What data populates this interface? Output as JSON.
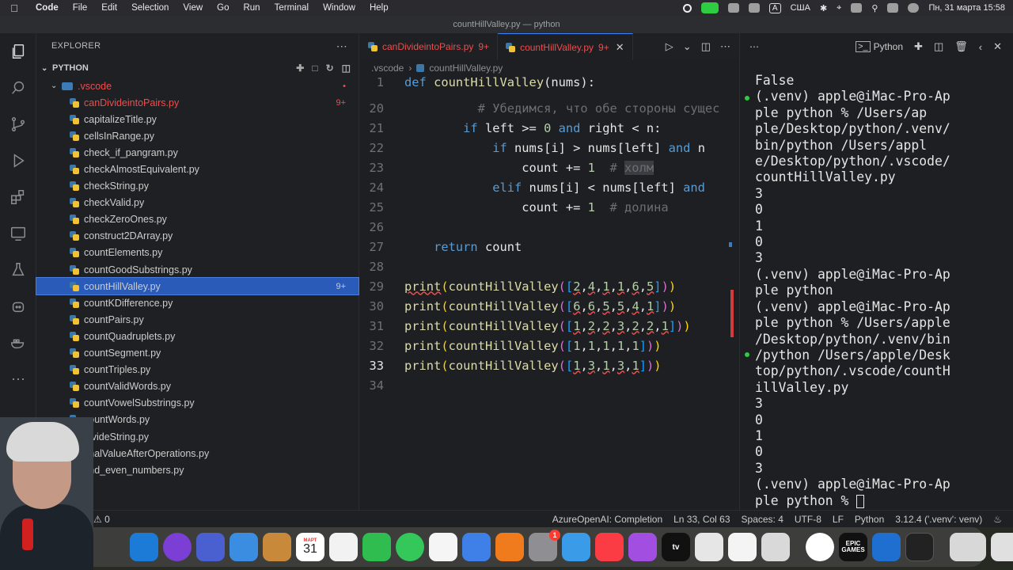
{
  "menubar": {
    "app": "Code",
    "items": [
      "File",
      "Edit",
      "Selection",
      "View",
      "Go",
      "Run",
      "Terminal",
      "Window",
      "Help"
    ],
    "input_source": "США",
    "input_source_key": "A",
    "clock": "Пн, 31 марта  15:58"
  },
  "window_title": "countHillValley.py — python",
  "sidebar": {
    "header": "EXPLORER",
    "section": "PYTHON",
    "folder": ".vscode",
    "files": [
      {
        "name": "canDivideintoPairs.py",
        "badge": "9+",
        "error": true,
        "selected": false
      },
      {
        "name": "capitalizeTitle.py",
        "badge": "",
        "error": false,
        "selected": false
      },
      {
        "name": "cellsInRange.py",
        "badge": "",
        "error": false,
        "selected": false
      },
      {
        "name": "check_if_pangram.py",
        "badge": "",
        "error": false,
        "selected": false
      },
      {
        "name": "checkAlmostEquivalent.py",
        "badge": "",
        "error": false,
        "selected": false
      },
      {
        "name": "checkString.py",
        "badge": "",
        "error": false,
        "selected": false
      },
      {
        "name": "checkValid.py",
        "badge": "",
        "error": false,
        "selected": false
      },
      {
        "name": "checkZeroOnes.py",
        "badge": "",
        "error": false,
        "selected": false
      },
      {
        "name": "construct2DArray.py",
        "badge": "",
        "error": false,
        "selected": false
      },
      {
        "name": "countElements.py",
        "badge": "",
        "error": false,
        "selected": false
      },
      {
        "name": "countGoodSubstrings.py",
        "badge": "",
        "error": false,
        "selected": false
      },
      {
        "name": "countHillValley.py",
        "badge": "9+",
        "error": false,
        "selected": true
      },
      {
        "name": "countKDifference.py",
        "badge": "",
        "error": false,
        "selected": false
      },
      {
        "name": "countPairs.py",
        "badge": "",
        "error": false,
        "selected": false
      },
      {
        "name": "countQuadruplets.py",
        "badge": "",
        "error": false,
        "selected": false
      },
      {
        "name": "countSegment.py",
        "badge": "",
        "error": false,
        "selected": false
      },
      {
        "name": "countTriples.py",
        "badge": "",
        "error": false,
        "selected": false
      },
      {
        "name": "countValidWords.py",
        "badge": "",
        "error": false,
        "selected": false
      },
      {
        "name": "countVowelSubstrings.py",
        "badge": "",
        "error": false,
        "selected": false
      },
      {
        "name": "countWords.py",
        "badge": "",
        "error": false,
        "selected": false
      },
      {
        "name": "divideString.py",
        "badge": "",
        "error": false,
        "selected": false
      },
      {
        "name": "finalValueAfterOperations.py",
        "badge": "",
        "error": false,
        "selected": false
      },
      {
        "name": "find_even_numbers.py",
        "badge": "",
        "error": false,
        "selected": false
      }
    ]
  },
  "editor": {
    "tabs": [
      {
        "label": "canDivideintoPairs.py",
        "badge": "9+",
        "active": false
      },
      {
        "label": "countHillValley.py",
        "badge": "9+",
        "active": true
      }
    ],
    "breadcrumb": [
      ".vscode",
      "countHillValley.py"
    ],
    "lines": {
      "l1": {
        "n": "1",
        "def": "def",
        "name": "countHillValley",
        "rest": "(nums):"
      },
      "l20": {
        "n": "20",
        "comment": "# Убедимся, что обе стороны сущес"
      },
      "l21": {
        "n": "21",
        "if": "if",
        "a": " left >= ",
        "zero": "0",
        "and": " and",
        "b": " right < n:"
      },
      "l22": {
        "n": "22",
        "if": "if",
        "a": " nums[i] > nums[left] ",
        "and": "and",
        "b": " n"
      },
      "l23": {
        "n": "23",
        "a": "count += ",
        "one": "1",
        "comment": "  # ",
        "word": "холм"
      },
      "l24": {
        "n": "24",
        "elif": "elif",
        "a": " nums[i] < nums[left] ",
        "and": "and"
      },
      "l25": {
        "n": "25",
        "a": "count += ",
        "one": "1",
        "comment": "  # долина"
      },
      "l26": {
        "n": "26"
      },
      "l27": {
        "n": "27",
        "ret": "return",
        "a": " count"
      },
      "l28": {
        "n": "28"
      },
      "l29": {
        "n": "29",
        "p": "print",
        "f": "countHillValley",
        "args": [
          "2",
          "4",
          "1",
          "1",
          "6",
          "5"
        ]
      },
      "l30": {
        "n": "30",
        "p": "print",
        "f": "countHillValley",
        "args": [
          "6",
          "6",
          "5",
          "5",
          "4",
          "1"
        ]
      },
      "l31": {
        "n": "31",
        "p": "print",
        "f": "countHillValley",
        "args": [
          "1",
          "2",
          "2",
          "3",
          "2",
          "2",
          "1"
        ]
      },
      "l32": {
        "n": "32",
        "p": "print",
        "f": "countHillValley",
        "args": [
          "1",
          "1",
          "1",
          "1",
          "1"
        ]
      },
      "l33": {
        "n": "33",
        "p": "print",
        "f": "countHillValley",
        "args": [
          "1",
          "3",
          "1",
          "3",
          "1"
        ]
      },
      "l34": {
        "n": "34"
      }
    }
  },
  "terminal": {
    "shell": "Python",
    "lines": [
      "False",
      "(.venv) apple@iMac-Pro-Ap",
      "ple python % /Users/ap",
      "ple/Desktop/python/.venv/",
      "bin/python /Users/appl",
      "e/Desktop/python/.vscode/",
      "countHillValley.py",
      "3",
      "0",
      "1",
      "0",
      "3",
      "(.venv) apple@iMac-Pro-Ap",
      "ple python",
      "(.venv) apple@iMac-Pro-Ap",
      "ple python % /Users/apple",
      "/Desktop/python/.venv/bin",
      "/python /Users/apple/Desk",
      "top/python/.vscode/countH",
      "illValley.py",
      "3",
      "0",
      "1",
      "0",
      "3",
      "(.venv) apple@iMac-Pro-Ap",
      "ple python % "
    ]
  },
  "statusbar": {
    "problems": "0",
    "items": [
      "AzureOpenAI: Completion",
      "Ln 33, Col 63",
      "Spaces: 4",
      "UTF-8",
      "LF",
      "Python",
      "3.12.4 ('.venv': venv)"
    ]
  },
  "dock": {
    "calendar_month": "МАРТ",
    "calendar_day": "31",
    "epic_label": "EPIC GAMES",
    "appletv_label": "tv",
    "notification_badge": "1"
  }
}
